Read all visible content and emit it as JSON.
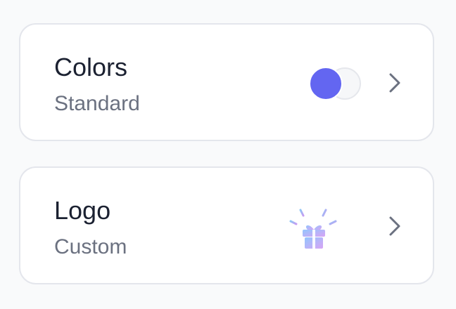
{
  "settings": {
    "colors": {
      "title": "Colors",
      "value": "Standard",
      "accent_color": "#6366f1",
      "secondary_color": "#f6f7f9",
      "trailing_icon": "chevron-right-icon"
    },
    "logo": {
      "title": "Logo",
      "value": "Custom",
      "preview_icon": "gift-icon",
      "trailing_icon": "chevron-right-icon"
    }
  }
}
